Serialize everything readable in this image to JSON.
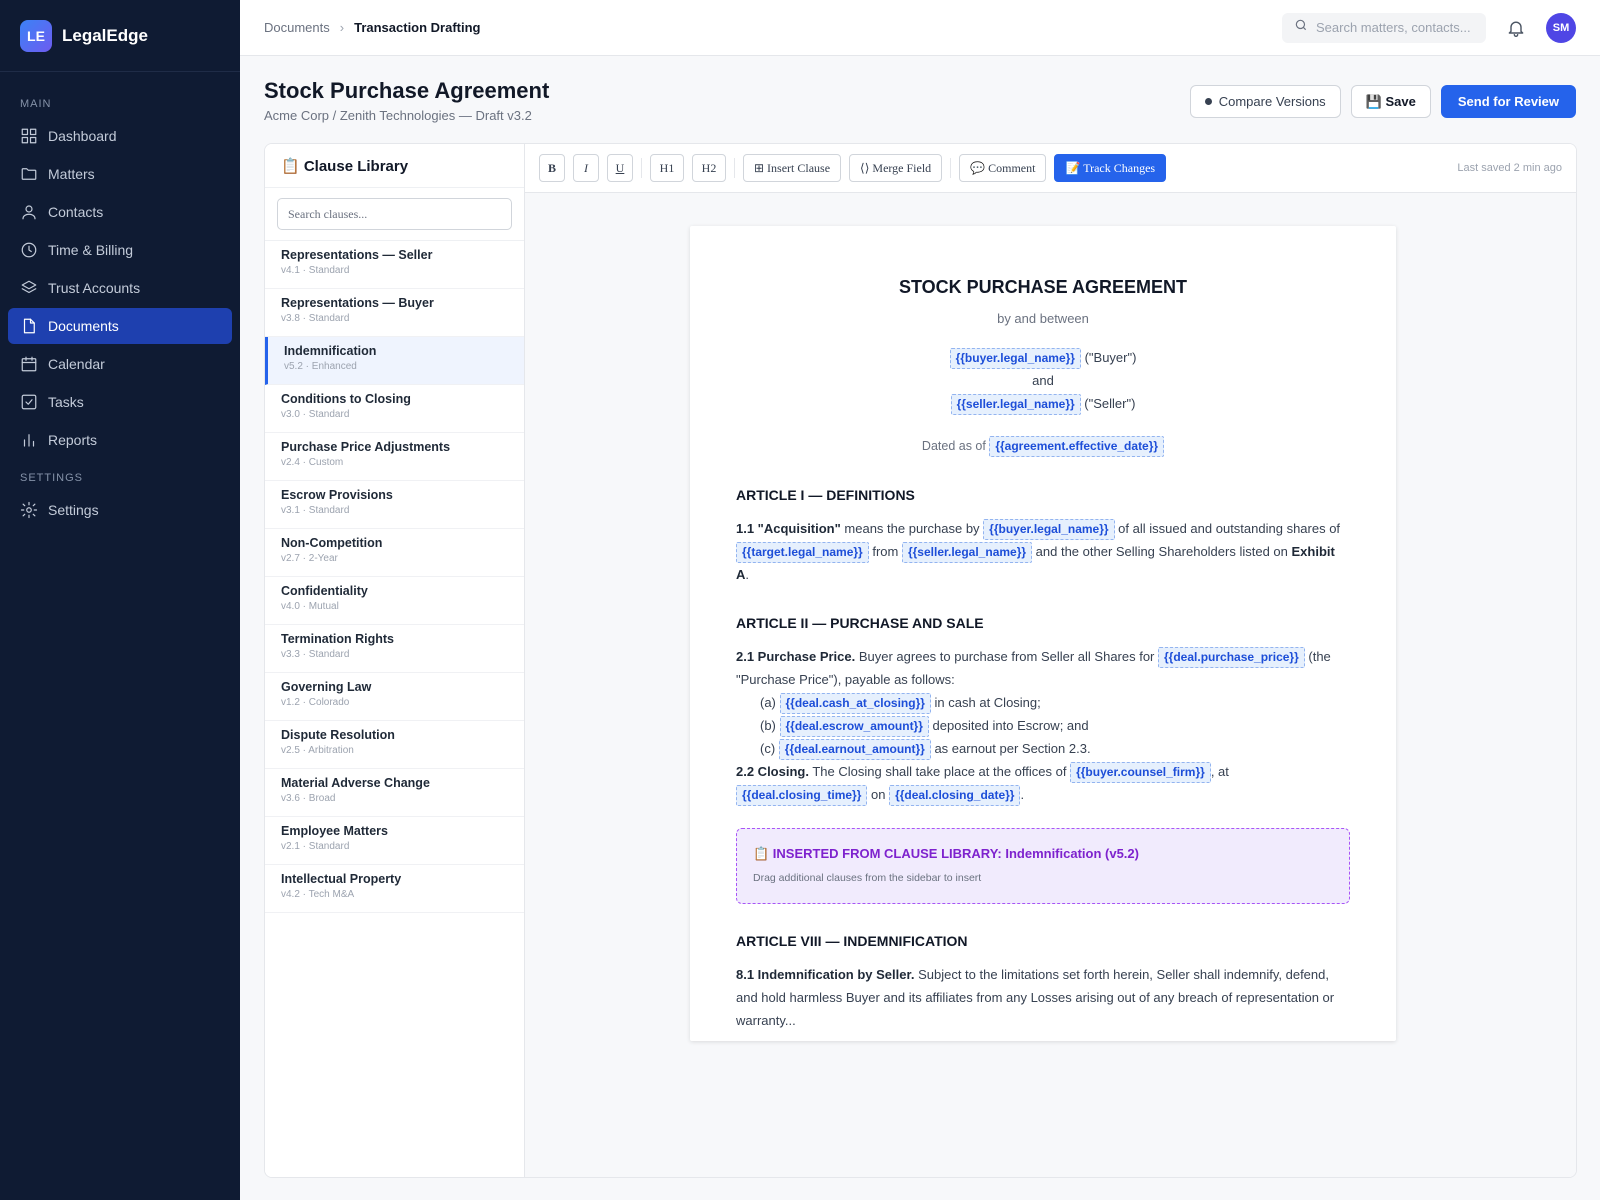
{
  "app": {
    "logo_text": "LE",
    "name": "LegalEdge"
  },
  "sidebar": {
    "section_main": "MAIN",
    "section_settings": "SETTINGS",
    "items": [
      {
        "label": "Dashboard",
        "icon": "dashboard-icon"
      },
      {
        "label": "Matters",
        "icon": "folder-icon"
      },
      {
        "label": "Contacts",
        "icon": "user-icon"
      },
      {
        "label": "Time & Billing",
        "icon": "clock-icon"
      },
      {
        "label": "Trust Accounts",
        "icon": "layers-icon"
      },
      {
        "label": "Documents",
        "icon": "document-icon",
        "active": true
      },
      {
        "label": "Calendar",
        "icon": "calendar-icon"
      },
      {
        "label": "Tasks",
        "icon": "checkbox-icon"
      },
      {
        "label": "Reports",
        "icon": "bar-chart-icon"
      }
    ],
    "settings_item": {
      "label": "Settings",
      "icon": "gear-icon"
    }
  },
  "topbar": {
    "breadcrumb": [
      "Documents",
      "Transaction Drafting"
    ],
    "breadcrumb_sep": "›",
    "search_placeholder": "Search matters, contacts...",
    "avatar_initials": "SM"
  },
  "page": {
    "title": "Stock Purchase Agreement",
    "subtitle": "Acme Corp / Zenith Technologies — Draft v3.2",
    "compare_label": "Compare Versions",
    "save_label": "💾 Save",
    "send_label": "Send for Review"
  },
  "library": {
    "title": "📋 Clause Library",
    "search_placeholder": "Search clauses...",
    "clauses": [
      {
        "title": "Representations — Seller",
        "meta": "v4.1 · Standard"
      },
      {
        "title": "Representations — Buyer",
        "meta": "v3.8 · Standard"
      },
      {
        "title": "Indemnification",
        "meta": "v5.2 · Enhanced",
        "selected": true
      },
      {
        "title": "Conditions to Closing",
        "meta": "v3.0 · Standard"
      },
      {
        "title": "Purchase Price Adjustments",
        "meta": "v2.4 · Custom"
      },
      {
        "title": "Escrow Provisions",
        "meta": "v3.1 · Standard"
      },
      {
        "title": "Non-Competition",
        "meta": "v2.7 · 2-Year"
      },
      {
        "title": "Confidentiality",
        "meta": "v4.0 · Mutual"
      },
      {
        "title": "Termination Rights",
        "meta": "v3.3 · Standard"
      },
      {
        "title": "Governing Law",
        "meta": "v1.2 · Colorado"
      },
      {
        "title": "Dispute Resolution",
        "meta": "v2.5 · Arbitration"
      },
      {
        "title": "Material Adverse Change",
        "meta": "v3.6 · Broad"
      },
      {
        "title": "Employee Matters",
        "meta": "v2.1 · Standard"
      },
      {
        "title": "Intellectual Property",
        "meta": "v4.2 · Tech M&A"
      }
    ]
  },
  "toolbar": {
    "bold": "B",
    "italic": "I",
    "underline": "U",
    "h1": "H1",
    "h2": "H2",
    "insert_clause": "⊞ Insert Clause",
    "merge_field": "⟨⟩ Merge Field",
    "comment": "💬 Comment",
    "track_changes": "📝 Track Changes",
    "last_saved": "Last saved 2 min ago"
  },
  "document": {
    "title": "STOCK PURCHASE AGREEMENT",
    "between": "by and between",
    "buyer_field": "{{buyer.legal_name}}",
    "buyer_role": " (\"Buyer\")",
    "and": "and",
    "seller_field": "{{seller.legal_name}}",
    "seller_role": " (\"Seller\")",
    "dated_prefix": "Dated as of ",
    "date_field": "{{agreement.effective_date}}",
    "article1": "ARTICLE I — DEFINITIONS",
    "p11_num": "1.1 \"Acquisition\"",
    "p11_a": " means the purchase by ",
    "p11_f1": "{{buyer.legal_name}}",
    "p11_b": " of all issued and outstanding shares of ",
    "p11_f2": "{{target.legal_name}}",
    "p11_c": " from ",
    "p11_f3": "{{seller.legal_name}}",
    "p11_d": " and the other Selling Shareholders listed on ",
    "p11_exhibit": "Exhibit A",
    "p11_e": ".",
    "article2": "ARTICLE II — PURCHASE AND SALE",
    "p21_num": "2.1 Purchase Price.",
    "p21_a": " Buyer agrees to purchase from Seller all Shares for ",
    "p21_f": "{{deal.purchase_price}}",
    "p21_b": " (the \"Purchase Price\"), payable as follows:",
    "item_a_label": "(a)",
    "item_a_field": "{{deal.cash_at_closing}}",
    "item_a_text": " in cash at Closing;",
    "item_b_label": "(b)",
    "item_b_field": "{{deal.escrow_amount}}",
    "item_b_text": " deposited into Escrow; and",
    "item_c_label": "(c)",
    "item_c_field": "{{deal.earnout_amount}}",
    "item_c_text": " as earnout per Section 2.3.",
    "p22_num": "2.2 Closing.",
    "p22_a": " The Closing shall take place at the offices of ",
    "p22_f1": "{{buyer.counsel_firm}}",
    "p22_b": ", at ",
    "p22_f2": "{{deal.closing_time}}",
    "p22_c": " on ",
    "p22_f3": "{{deal.closing_date}}",
    "p22_d": ".",
    "inserted_title": "📋 INSERTED FROM CLAUSE LIBRARY: Indemnification (v5.2)",
    "inserted_hint": "Drag additional clauses from the sidebar to insert",
    "article8": "ARTICLE VIII — INDEMNIFICATION",
    "p81_num": "8.1 Indemnification by Seller.",
    "p81_text": " Subject to the limitations set forth herein, Seller shall indemnify, defend, and hold harmless Buyer and its affiliates from any Losses arising out of any breach of representation or warranty..."
  },
  "colors": {
    "sidebar_bg": "#0f1b33",
    "accent": "#2563eb",
    "field_bg": "#e6f0fd",
    "inserted_bg": "#f1ebfd",
    "inserted_border": "#a855f7"
  }
}
